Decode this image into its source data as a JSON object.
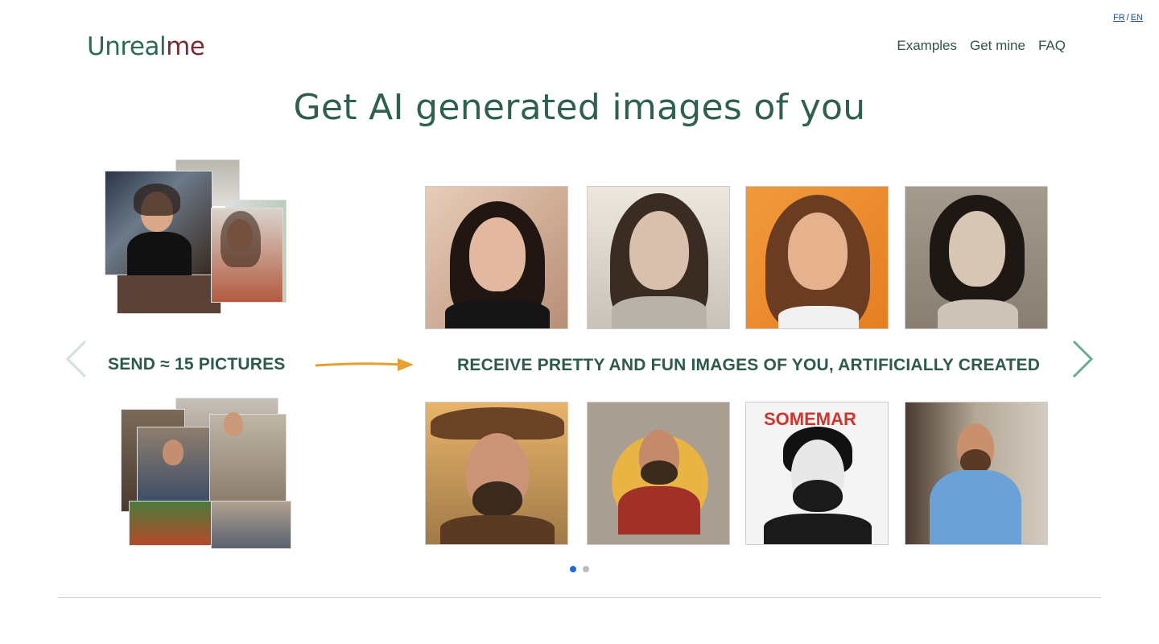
{
  "lang": {
    "fr": "FR",
    "sep": "/",
    "en": "EN"
  },
  "brand": {
    "part1": "Unreal",
    "part2": "me"
  },
  "nav": {
    "items": [
      "Examples",
      "Get mine",
      "FAQ"
    ]
  },
  "hero": {
    "title": "Get AI generated images of you"
  },
  "slide": {
    "send_label": "SEND ≈ 15 PICTURES",
    "receive_label": "RECEIVE PRETTY AND FUN IMAGES OF YOU, ARTIFICIALLY CREATED",
    "comic_title": "SOMEMAR"
  },
  "carousel": {
    "slide_count": 2,
    "active_index": 0
  },
  "colors": {
    "accent": "#2e5f50",
    "brand_dark": "#7a2a33",
    "dot_active": "#2266dd",
    "arrow": "#6aaa9a",
    "arrow_light": "#cfe3dc",
    "orange_arrow": "#e8a030"
  }
}
